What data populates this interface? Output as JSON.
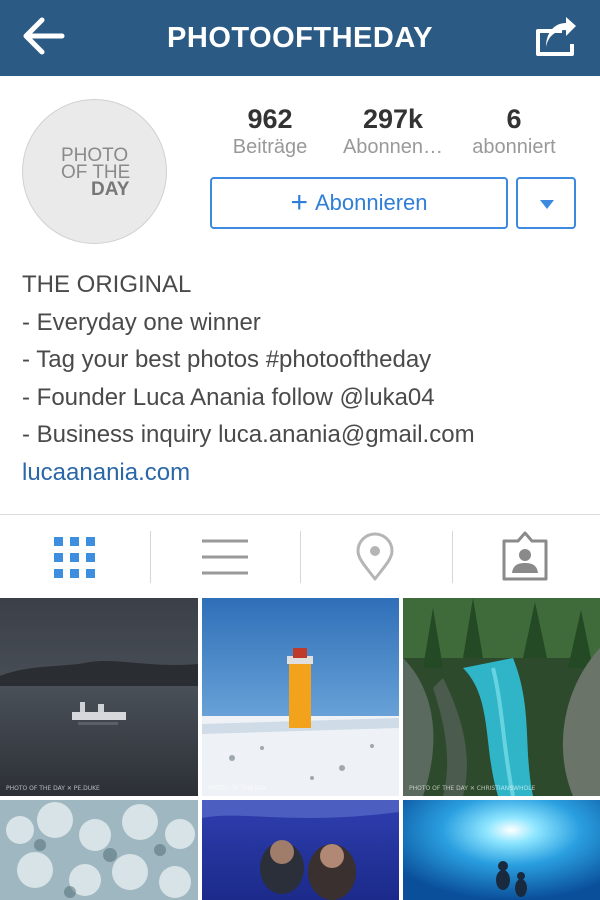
{
  "header": {
    "title": "PHOTOOFTHEDAY",
    "back_icon": "back-arrow-icon",
    "share_icon": "share-icon",
    "background": "#2b5b84"
  },
  "profile": {
    "avatar_text": [
      "PHOTO",
      "OF THE",
      "DAY"
    ],
    "stats": [
      {
        "value": "962",
        "label": "Beiträge"
      },
      {
        "value": "297k",
        "label": "Abonnen…"
      },
      {
        "value": "6",
        "label": "abonniert"
      }
    ],
    "follow_button": "Abonnieren",
    "accent": "#3b8ae0"
  },
  "bio": {
    "lines": [
      "THE ORIGINAL",
      "- Everyday one winner",
      "- Tag your best photos #photooftheday",
      "- Founder Luca Anania follow @luka04",
      "- Business inquiry luca.anania@gmail.com"
    ],
    "link": "lucaanania.com"
  },
  "tabs": [
    {
      "icon": "grid-icon",
      "active": true
    },
    {
      "icon": "list-icon",
      "active": false
    },
    {
      "icon": "location-pin-icon",
      "active": false
    },
    {
      "icon": "tagged-person-icon",
      "active": false
    }
  ],
  "grid": {
    "captions": [
      "PHOTO OF THE DAY  ✕  PE.DUKE",
      "PHOTO OF THE DAY",
      "PHOTO OF THE DAY  ✕  CHRISTIANSWHOLE"
    ]
  }
}
